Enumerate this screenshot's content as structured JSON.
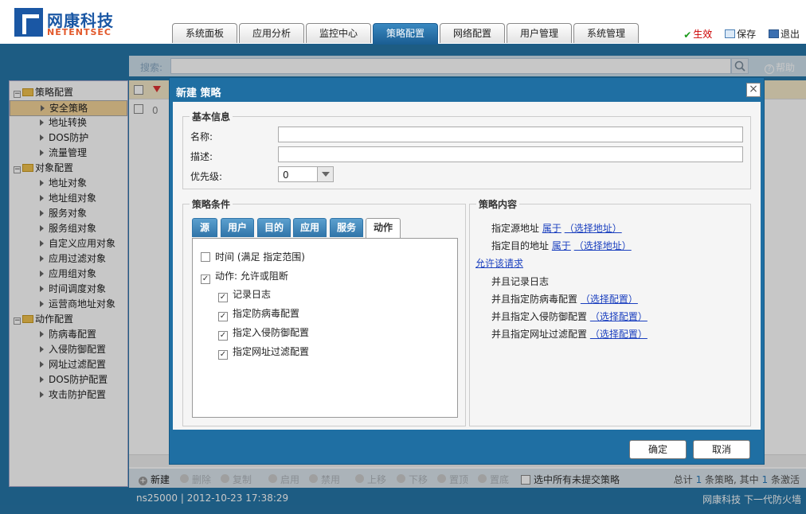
{
  "header": {
    "logo_cn": "网康科技",
    "logo_en": "NETENTSEC",
    "tabs": [
      "系统面板",
      "应用分析",
      "监控中心",
      "策略配置",
      "网络配置",
      "用户管理",
      "系统管理"
    ],
    "active_tab": 3,
    "apply": "生效",
    "save": "保存",
    "logout": "退出"
  },
  "search": {
    "label": "搜索:",
    "help": "帮助"
  },
  "sidebar": {
    "items": [
      {
        "label": "策略配置",
        "level": 0
      },
      {
        "label": "安全策略",
        "level": 1,
        "selected": true
      },
      {
        "label": "地址转换",
        "level": 1
      },
      {
        "label": "DOS防护",
        "level": 1
      },
      {
        "label": "流量管理",
        "level": 1
      },
      {
        "label": "对象配置",
        "level": 0
      },
      {
        "label": "地址对象",
        "level": 1
      },
      {
        "label": "地址组对象",
        "level": 1
      },
      {
        "label": "服务对象",
        "level": 1
      },
      {
        "label": "服务组对象",
        "level": 1
      },
      {
        "label": "自定义应用对象",
        "level": 1
      },
      {
        "label": "应用过滤对象",
        "level": 1
      },
      {
        "label": "应用组对象",
        "level": 1
      },
      {
        "label": "时间调度对象",
        "level": 1
      },
      {
        "label": "运营商地址对象",
        "level": 1
      },
      {
        "label": "动作配置",
        "level": 0
      },
      {
        "label": "防病毒配置",
        "level": 1
      },
      {
        "label": "入侵防御配置",
        "level": 1
      },
      {
        "label": "网址过滤配置",
        "level": 1
      },
      {
        "label": "DOS防护配置",
        "level": 1
      },
      {
        "label": "攻击防护配置",
        "level": 1
      }
    ]
  },
  "main": {
    "row_num": "0"
  },
  "toolbar": {
    "new": "新建",
    "delete": "删除",
    "copy": "复制",
    "enable": "启用",
    "disable": "禁用",
    "up": "上移",
    "down": "下移",
    "top": "置顶",
    "bottom": "置底",
    "select_uncommitted": "选中所有未提交策略",
    "summary_pre": "总计",
    "total": "1",
    "summary_mid": "条策略, 其中",
    "active": "1",
    "summary_post": "条激活"
  },
  "status": {
    "left": "ns25000 | 2012-10-23 17:38:29",
    "right": "网康科技 下一代防火墙"
  },
  "dialog": {
    "title": "新建 策略",
    "basic_legend": "基本信息",
    "name_label": "名称:",
    "name_value": "",
    "desc_label": "描述:",
    "desc_value": "",
    "priority_label": "优先级:",
    "priority_value": "0",
    "cond_legend": "策略条件",
    "cond_tabs": [
      "源",
      "用户",
      "目的",
      "应用",
      "服务",
      "动作"
    ],
    "active_cond_tab": 5,
    "conditions": [
      {
        "label": "时间 (满足 指定范围)",
        "checked": false,
        "indent": false
      },
      {
        "label": "动作: 允许或阻断",
        "checked": true,
        "indent": false
      },
      {
        "label": "记录日志",
        "checked": true,
        "indent": true
      },
      {
        "label": "指定防病毒配置",
        "checked": true,
        "indent": true
      },
      {
        "label": "指定入侵防御配置",
        "checked": true,
        "indent": true
      },
      {
        "label": "指定网址过滤配置",
        "checked": true,
        "indent": true
      }
    ],
    "content_legend": "策略内容",
    "content": {
      "src_pre": "指定源地址",
      "src_link1": "属于",
      "src_link2": "（选择地址）",
      "dst_pre": "指定目的地址",
      "dst_link1": "属于",
      "dst_link2": "（选择地址）",
      "allow": "允许该请求",
      "log": "并且记录日志",
      "av_pre": "并且指定防病毒配置",
      "av_link": "（选择配置）",
      "ips_pre": "并且指定入侵防御配置",
      "ips_link": "（选择配置）",
      "url_pre": "并且指定网址过滤配置",
      "url_link": "（选择配置）"
    },
    "ok": "确定",
    "cancel": "取消"
  }
}
